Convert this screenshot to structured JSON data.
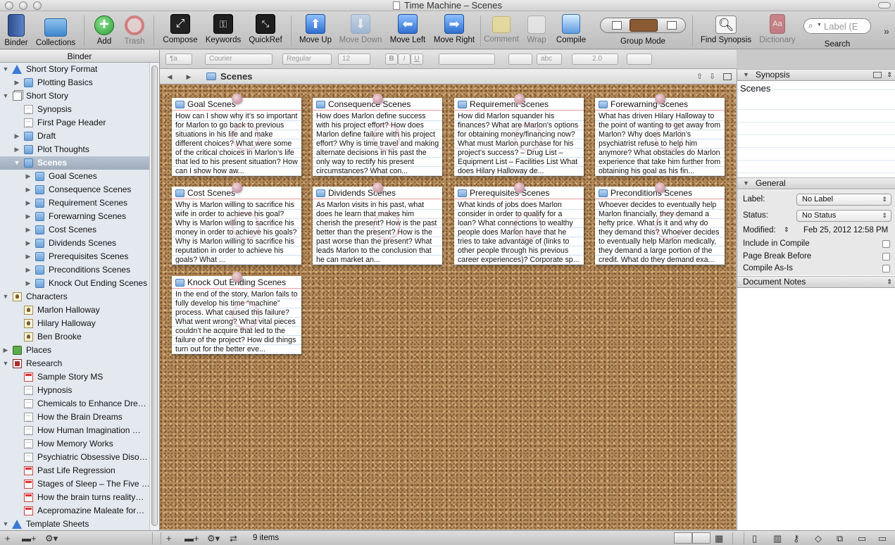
{
  "window": {
    "title": "Time Machine – Scenes"
  },
  "toolbar": {
    "binder": "Binder",
    "collections": "Collections",
    "add": "Add",
    "trash": "Trash",
    "compose": "Compose",
    "keywords": "Keywords",
    "quickref": "QuickRef",
    "move_up": "Move Up",
    "move_down": "Move Down",
    "move_left": "Move Left",
    "move_right": "Move Right",
    "comment": "Comment",
    "wrap": "Wrap",
    "compile": "Compile",
    "group_mode": "Group Mode",
    "find_synopsis": "Find Synopsis",
    "dictionary": "Dictionary",
    "search": "Search",
    "search_placeholder": "Label (E"
  },
  "formatbar": {
    "style": "¶a",
    "font": "Courier",
    "weight": "Regular",
    "size": "12",
    "bold": "B",
    "italic": "I",
    "underline": "U",
    "line_spacing": "2.0",
    "highlight": "abc"
  },
  "binder": {
    "header": "Binder",
    "items": [
      {
        "label": "Short Story Format"
      },
      {
        "label": "Plotting Basics"
      },
      {
        "label": "Short Story"
      },
      {
        "label": "Synopsis"
      },
      {
        "label": "First Page Header"
      },
      {
        "label": "Draft"
      },
      {
        "label": "Plot Thoughts"
      },
      {
        "label": "Scenes"
      },
      {
        "label": "Goal Scenes"
      },
      {
        "label": "Consequence Scenes"
      },
      {
        "label": "Requirement Scenes"
      },
      {
        "label": "Forewarning Scenes"
      },
      {
        "label": "Cost Scenes"
      },
      {
        "label": "Dividends Scenes"
      },
      {
        "label": "Prerequisites Scenes"
      },
      {
        "label": "Preconditions Scenes"
      },
      {
        "label": "Knock Out Ending Scenes"
      },
      {
        "label": "Characters"
      },
      {
        "label": "Marlon Halloway"
      },
      {
        "label": "Hilary Halloway"
      },
      {
        "label": "Ben Brooke"
      },
      {
        "label": "Places"
      },
      {
        "label": "Research"
      },
      {
        "label": "Sample Story MS"
      },
      {
        "label": "Hypnosis"
      },
      {
        "label": "Chemicals to Enhance Dre…"
      },
      {
        "label": "How the Brain Dreams"
      },
      {
        "label": "How Human Imagination …"
      },
      {
        "label": "How Memory Works"
      },
      {
        "label": "Psychiatric Obsessive Diso…"
      },
      {
        "label": "Past Life Regression"
      },
      {
        "label": "Stages of Sleep – The Five …"
      },
      {
        "label": "How the brain turns reality…"
      },
      {
        "label": "Acepromazine Maleate for…"
      },
      {
        "label": "Template Sheets"
      }
    ]
  },
  "editor": {
    "title": "Scenes",
    "item_count": "9 items"
  },
  "cards": [
    {
      "title": "Goal Scenes",
      "body": "How can I show why it’s so important for Marlon to go back to previous situations in his life and make different choices? What were some of the critical choices in Marlon’s life that led to his present situation? How can I show how aw..."
    },
    {
      "title": "Consequence Scenes",
      "body": "How does Marlon define success with his project effort? How does Marlon define failure with his project effort? Why is time travel and making alternate decisions in his past the only way to rectify his present circumstances? What con..."
    },
    {
      "title": "Requirement Scenes",
      "body": "How did Marlon squander his finances? What are Marlon’s options for obtaining money/financing now? What must Marlon purchase for his project’s success?  – Drug List  – Equipment List  – Facilities List What does Hilary Halloway de..."
    },
    {
      "title": "Forewarning Scenes",
      "body": "What has driven Hilary Halloway to the point of wanting to get away from Marlon? Why does Marlon’s psychiatrist refuse to help him anymore? What obstacles do Marlon experience that take him further from obtaining his goal as his fin..."
    },
    {
      "title": "Cost Scenes",
      "body": "Why is Marlon willing to sacrifice his wife in order to achieve his goal? Why is Marlon willing to sacrifice his money in order to achieve his goals? Why is Marlon willing to sacrifice his reputation in order to achieve his goals? What ..."
    },
    {
      "title": "Dividends Scenes",
      "body": "As Marlon visits in his past, what does he learn that makes him cherish the present? How is the past better than the present? How is the past worse than the present? What leads Marlon to the conclusion that he can market an..."
    },
    {
      "title": "Prerequisites Scenes",
      "body": "What kinds of jobs does Marlon consider in order to qualify for a loan? What connections to wealthy people does Marlon have that he tries to take advantage of (links to other people through his previous career experiences)? Corporate sp..."
    },
    {
      "title": "Preconditions Scenes",
      "body": "Whoever decides to eventually help Marlon financially, they demand a hefty price. What is it and why do they demand this? Whoever decides to eventually help Marlon medically, they demand a large portion of the credit. What do they demand exa..."
    },
    {
      "title": "Knock Out Ending Scenes",
      "body": "In the end of the story, Marlon fails to fully develop his time “machine” process. What caused this failure? What went wrong? What vital pieces couldn’t he acquire that led to the failure of the project? How did things turn out for the better eve..."
    }
  ],
  "inspector": {
    "synopsis_header": "Synopsis",
    "synopsis_text": "Scenes",
    "general_header": "General",
    "label_label": "Label:",
    "label_value": "No Label",
    "status_label": "Status:",
    "status_value": "No Status",
    "modified_label": "Modified:",
    "modified_value": "Feb 25, 2012 12:58 PM",
    "include_compile": "Include in Compile",
    "page_break": "Page Break Before",
    "compile_as_is": "Compile As-Is",
    "notes_header": "Document Notes"
  },
  "colors": {
    "accent_blue": "#3a7bd5",
    "add_green": "#2e9e36",
    "cork": "#b48a5a",
    "selection": "#a6b2c1"
  }
}
